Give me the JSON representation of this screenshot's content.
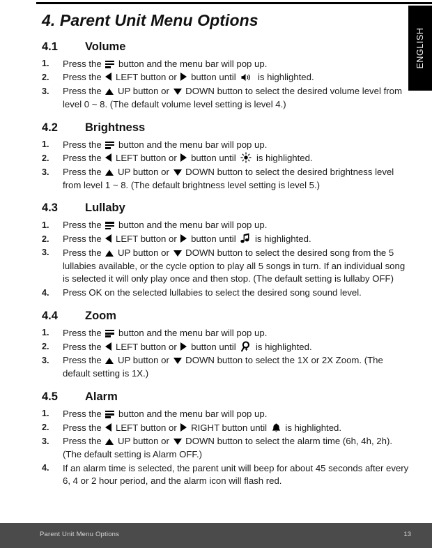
{
  "document": {
    "title": "4. Parent Unit Menu Options",
    "language_tab": "ENGLISH"
  },
  "sections": [
    {
      "number": "4.1",
      "title": "Volume",
      "steps": [
        {
          "num": "1.",
          "parts": [
            {
              "t": "text",
              "v": "Press the "
            },
            {
              "t": "icon",
              "v": "menu-icon"
            },
            {
              "t": "text",
              "v": " button and the menu bar will pop up."
            }
          ]
        },
        {
          "num": "2.",
          "parts": [
            {
              "t": "text",
              "v": "Press the "
            },
            {
              "t": "icon",
              "v": "left-arrow-icon"
            },
            {
              "t": "text",
              "v": " LEFT button or "
            },
            {
              "t": "icon",
              "v": "right-arrow-icon"
            },
            {
              "t": "text",
              "v": " button until "
            },
            {
              "t": "icon",
              "v": "volume-speaker-icon"
            },
            {
              "t": "text",
              "v": " is highlighted."
            }
          ]
        },
        {
          "num": "3.",
          "parts": [
            {
              "t": "text",
              "v": "Press the "
            },
            {
              "t": "icon",
              "v": "up-arrow-icon"
            },
            {
              "t": "text",
              "v": " UP button or "
            },
            {
              "t": "icon",
              "v": "down-arrow-icon"
            },
            {
              "t": "text",
              "v": " DOWN button to select the desired volume level from level 0 ~ 8. (The default volume level setting is level 4.)"
            }
          ]
        }
      ]
    },
    {
      "number": "4.2",
      "title": "Brightness",
      "steps": [
        {
          "num": "1.",
          "parts": [
            {
              "t": "text",
              "v": "Press the "
            },
            {
              "t": "icon",
              "v": "menu-icon"
            },
            {
              "t": "text",
              "v": " button and the menu bar will pop up."
            }
          ]
        },
        {
          "num": "2.",
          "parts": [
            {
              "t": "text",
              "v": "Press the "
            },
            {
              "t": "icon",
              "v": "left-arrow-icon"
            },
            {
              "t": "text",
              "v": " LEFT button or "
            },
            {
              "t": "icon",
              "v": "right-arrow-icon"
            },
            {
              "t": "text",
              "v": " button until "
            },
            {
              "t": "icon",
              "v": "brightness-sun-icon"
            },
            {
              "t": "text",
              "v": " is highlighted."
            }
          ]
        },
        {
          "num": "3.",
          "parts": [
            {
              "t": "text",
              "v": "Press the "
            },
            {
              "t": "icon",
              "v": "up-arrow-icon"
            },
            {
              "t": "text",
              "v": " UP button or "
            },
            {
              "t": "icon",
              "v": "down-arrow-icon"
            },
            {
              "t": "text",
              "v": " DOWN button to select the desired brightness level from level 1 ~ 8. (The default brightness level setting is level 5.)"
            }
          ]
        }
      ]
    },
    {
      "number": "4.3",
      "title": "Lullaby",
      "steps": [
        {
          "num": "1.",
          "parts": [
            {
              "t": "text",
              "v": "Press the "
            },
            {
              "t": "icon",
              "v": "menu-icon"
            },
            {
              "t": "text",
              "v": " button and the menu bar will pop up."
            }
          ]
        },
        {
          "num": "2.",
          "parts": [
            {
              "t": "text",
              "v": "Press the "
            },
            {
              "t": "icon",
              "v": "left-arrow-icon"
            },
            {
              "t": "text",
              "v": " LEFT button or "
            },
            {
              "t": "icon",
              "v": "right-arrow-icon"
            },
            {
              "t": "text",
              "v": " button until "
            },
            {
              "t": "icon",
              "v": "music-note-icon"
            },
            {
              "t": "text",
              "v": " is highlighted."
            }
          ]
        },
        {
          "num": "3.",
          "parts": [
            {
              "t": "text",
              "v": "Press the "
            },
            {
              "t": "icon",
              "v": "up-arrow-icon"
            },
            {
              "t": "text",
              "v": " UP button or "
            },
            {
              "t": "icon",
              "v": "down-arrow-icon"
            },
            {
              "t": "text",
              "v": " DOWN button to select the desired song from the 5 lullabies available, or the cycle option to play all 5 songs in turn. If an individual song is selected it will only play once and then stop. (The default setting is lullaby OFF)"
            }
          ]
        },
        {
          "num": "4.",
          "parts": [
            {
              "t": "text",
              "v": "Press OK on the selected lullabies to select the desired song sound level."
            }
          ]
        }
      ]
    },
    {
      "number": "4.4",
      "title": "Zoom",
      "steps": [
        {
          "num": "1.",
          "parts": [
            {
              "t": "text",
              "v": "Press the "
            },
            {
              "t": "icon",
              "v": "menu-icon"
            },
            {
              "t": "text",
              "v": " button and the menu bar will pop up."
            }
          ]
        },
        {
          "num": "2.",
          "parts": [
            {
              "t": "text",
              "v": "Press the "
            },
            {
              "t": "icon",
              "v": "left-arrow-icon"
            },
            {
              "t": "text",
              "v": " LEFT button or "
            },
            {
              "t": "icon",
              "v": "right-arrow-icon"
            },
            {
              "t": "text",
              "v": " button until "
            },
            {
              "t": "icon",
              "v": "zoom-magnifier-icon"
            },
            {
              "t": "text",
              "v": " is highlighted."
            }
          ]
        },
        {
          "num": "3.",
          "parts": [
            {
              "t": "text",
              "v": "Press the "
            },
            {
              "t": "icon",
              "v": "up-arrow-icon"
            },
            {
              "t": "text",
              "v": " UP button or "
            },
            {
              "t": "icon",
              "v": "down-arrow-icon"
            },
            {
              "t": "text",
              "v": " DOWN button to select the 1X or 2X Zoom. (The default setting is 1X.)"
            }
          ]
        }
      ]
    },
    {
      "number": "4.5",
      "title": "Alarm",
      "steps": [
        {
          "num": "1.",
          "parts": [
            {
              "t": "text",
              "v": "Press the "
            },
            {
              "t": "icon",
              "v": "menu-icon"
            },
            {
              "t": "text",
              "v": " button and the menu bar will pop up."
            }
          ]
        },
        {
          "num": "2.",
          "parts": [
            {
              "t": "text",
              "v": "Press the "
            },
            {
              "t": "icon",
              "v": "left-arrow-icon"
            },
            {
              "t": "text",
              "v": " LEFT button or "
            },
            {
              "t": "icon",
              "v": "right-arrow-icon"
            },
            {
              "t": "text",
              "v": " RIGHT button until "
            },
            {
              "t": "icon",
              "v": "alarm-bell-icon"
            },
            {
              "t": "text",
              "v": " is highlighted."
            }
          ]
        },
        {
          "num": "3.",
          "parts": [
            {
              "t": "text",
              "v": "Press the "
            },
            {
              "t": "icon",
              "v": "up-arrow-icon"
            },
            {
              "t": "text",
              "v": " UP button or "
            },
            {
              "t": "icon",
              "v": "down-arrow-icon"
            },
            {
              "t": "text",
              "v": " DOWN button to select the alarm time (6h, 4h, 2h). (The default setting is Alarm OFF.)"
            }
          ]
        },
        {
          "num": "4.",
          "parts": [
            {
              "t": "text",
              "v": "If an alarm time is selected, the parent unit will beep for about 45 seconds after every 6, 4 or 2 hour period, and the alarm icon will flash red."
            }
          ]
        }
      ]
    }
  ],
  "footer": {
    "label": "Parent Unit Menu Options",
    "page_number": "13"
  },
  "colors": {
    "tab_background": "#000000",
    "footer_background": "#4b4b4b",
    "footer_text": "#d6d6d6",
    "body_text": "#1a1a1a"
  }
}
